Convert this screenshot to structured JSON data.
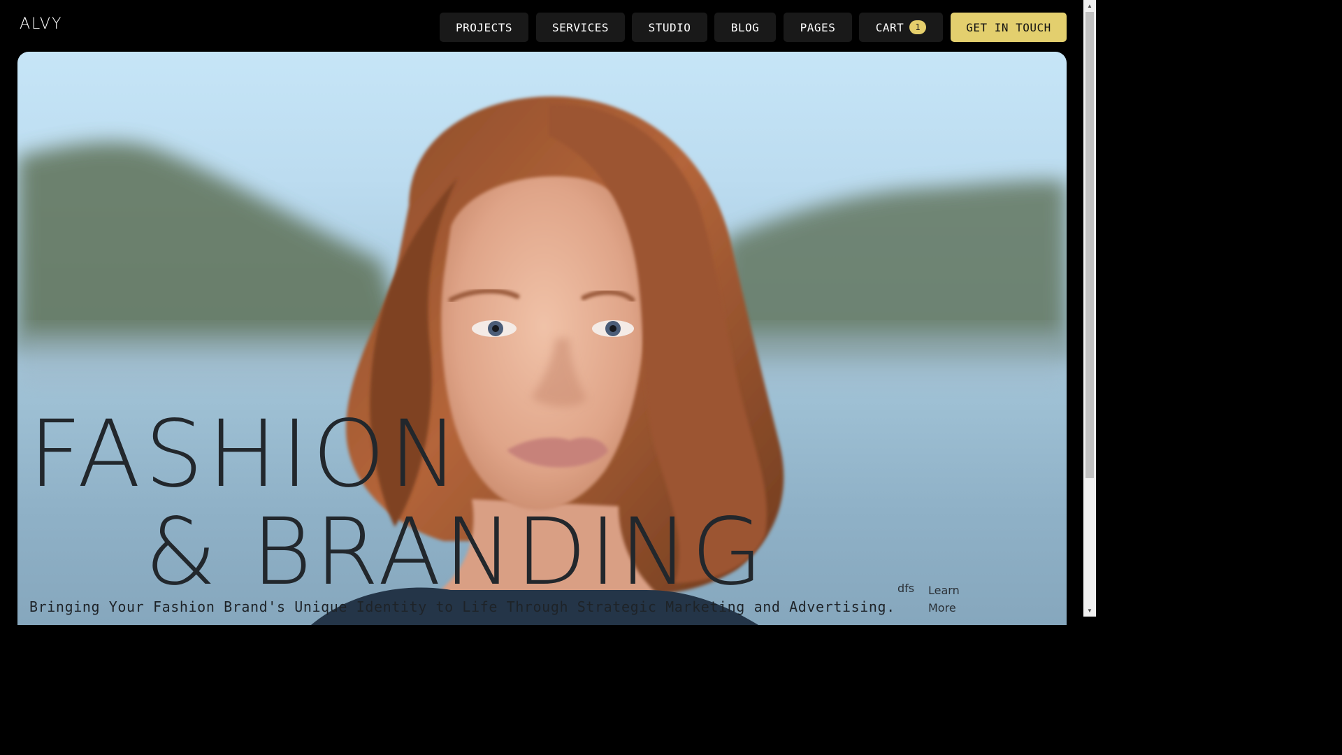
{
  "header": {
    "logo": "ALVY",
    "nav": [
      {
        "label": "PROJECTS"
      },
      {
        "label": "SERVICES"
      },
      {
        "label": "STUDIO"
      },
      {
        "label": "BLOG"
      },
      {
        "label": "PAGES"
      },
      {
        "label": "CART"
      }
    ],
    "cart_count": "1",
    "cta_label": "GET IN TOUCH"
  },
  "hero": {
    "headline_line1": "FASHION",
    "headline_line2": "& BRANDING",
    "tagline": "Bringing Your Fashion Brand's Unique Identity to Life Through Strategic Marketing and Advertising.",
    "aside_text": "dfs",
    "learn_more": "Learn More"
  },
  "colors": {
    "background": "#000000",
    "nav_button": "#191919",
    "accent": "#e3cf6e",
    "headline": "#22272c"
  },
  "scrollbar": {
    "up_icon": "arrow-up-icon",
    "down_icon": "arrow-down-icon"
  }
}
